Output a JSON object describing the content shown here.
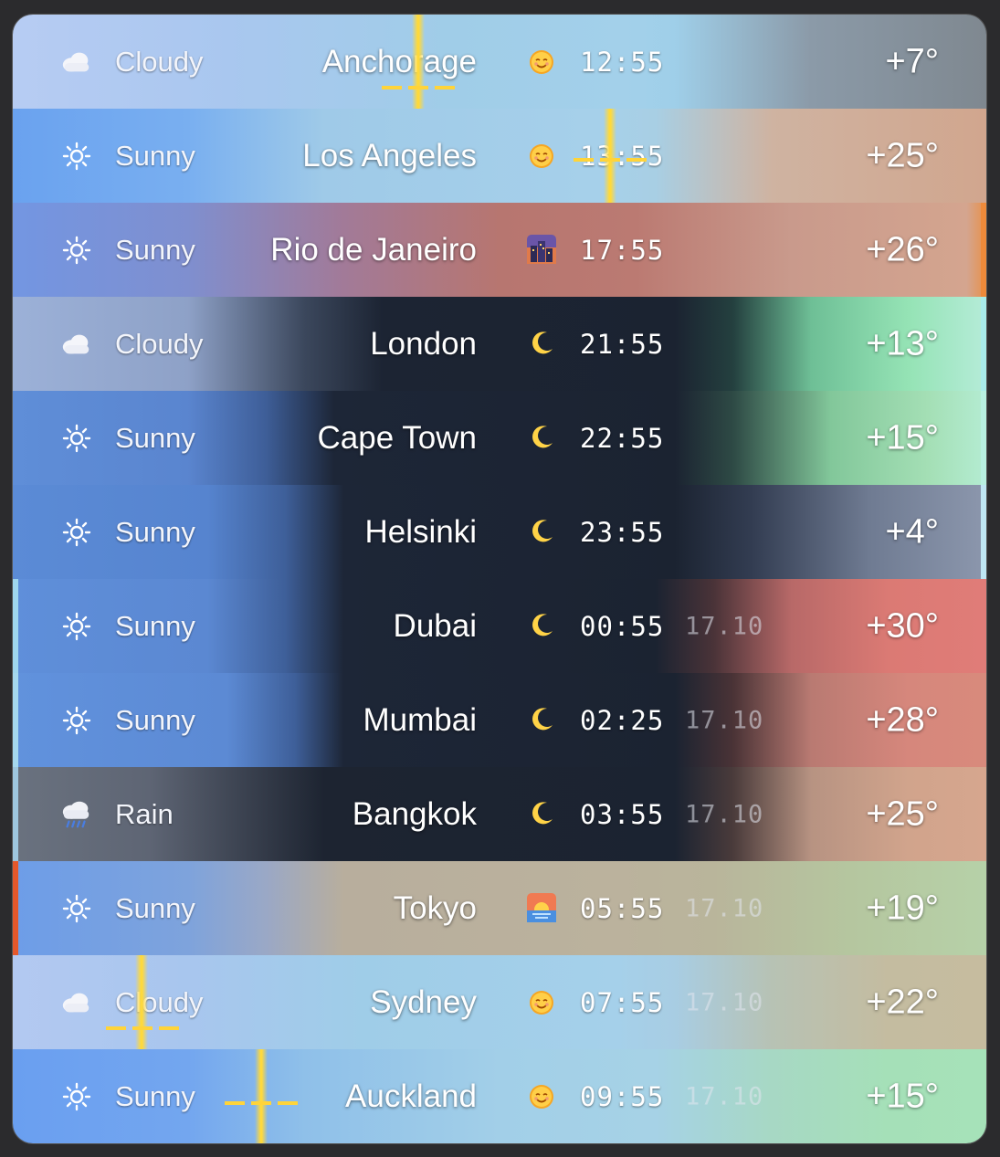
{
  "rows": [
    {
      "condition": "Cloudy",
      "cond_icon": "cloud-icon",
      "city": "Anchorage",
      "tod_icon": "sun-face-icon",
      "tod_glyph": "🌞",
      "time": "12:55",
      "date": "",
      "temp": "+7°",
      "bg": "linear-gradient(90deg,#b7ccf3 0%,#a9c7ef 22%,#a0cde8 45%,#a3d0ea 63%,#9fcfe9 68%,#8b9aa8 82%,#7f8890 100%)"
    },
    {
      "condition": "Sunny",
      "cond_icon": "sun-outline-icon",
      "city": "Los Angeles",
      "tod_icon": "sun-face-icon",
      "tod_glyph": "🌞",
      "time": "13:55",
      "date": "",
      "temp": "+25°",
      "bg": "linear-gradient(90deg,#6aa2ef 0%,#79aff0 18%,#9fcae8 32%,#a6d0ea 60%,#a8cfe4 66%,#cfb3a1 78%,#d1a68e 100%)"
    },
    {
      "condition": "Sunny",
      "cond_icon": "sun-outline-icon",
      "city": "Rio de Janeiro",
      "tod_icon": "dusk-city-icon",
      "tod_glyph": "🌆",
      "time": "17:55",
      "date": "",
      "temp": "+26°",
      "bg": "linear-gradient(90deg,#7396e2 0%,#7f8fcf 18%,#a27a98 34%,#b77670 50%,#bb7a72 64%,#c99a8c 80%,#d4a58f 98%,#e8914a 100%)"
    },
    {
      "condition": "Cloudy",
      "cond_icon": "cloud-icon",
      "city": "London",
      "tod_icon": "moon-icon",
      "tod_glyph": "🌙",
      "time": "21:55",
      "date": "",
      "temp": "+13°",
      "bg": "linear-gradient(90deg,#9cb1d8 0%,#8ea1c7 18%,#3b475c 30%,#1c2433 38%,#1b2331 68%,#24403f 74%,#6ebf96 82%,#95e3b5 92%,#b5ecd8 100%)"
    },
    {
      "condition": "Sunny",
      "cond_icon": "sun-outline-icon",
      "city": "Cape Town",
      "tod_icon": "moon-icon",
      "tod_glyph": "🌙",
      "time": "22:55",
      "date": "",
      "temp": "+15°",
      "bg": "linear-gradient(90deg,#5f8ed8 0%,#5a85cf 18%,#3e5e98 26%,#1d2637 33%,#1b2331 68%,#2e4a45 74%,#82c79a 84%,#a4dfb5 94%,#b4ecd2 100%)"
    },
    {
      "condition": "Sunny",
      "cond_icon": "sun-outline-icon",
      "city": "Helsinki",
      "tod_icon": "moon-icon",
      "tod_glyph": "🌙",
      "time": "23:55",
      "date": "",
      "temp": "+4°",
      "bg": "linear-gradient(90deg,#5b8bd6 0%,#5684cf 20%,#3e5f99 28%,#1d2637 34%,#1b2331 68%,#333d52 76%,#6f7b92 88%,#8c97ad 100%)"
    },
    {
      "condition": "Sunny",
      "cond_icon": "sun-outline-icon",
      "city": "Dubai",
      "tod_icon": "moon-icon",
      "tod_glyph": "🌙",
      "time": "00:55",
      "date": "17.10",
      "temp": "+30°",
      "bg": "linear-gradient(90deg,#5f8fda 0%,#5b88d2 20%,#3e5f99 28%,#1d2637 34%,#1b2331 66%,#4a3338 72%,#b86968 80%,#db7a74 90%,#e07c78 100%)"
    },
    {
      "condition": "Sunny",
      "cond_icon": "sun-outline-icon",
      "city": "Mumbai",
      "tod_icon": "moon-icon",
      "tod_glyph": "🌙",
      "time": "02:25",
      "date": "17.10",
      "temp": "+28°",
      "bg": "linear-gradient(90deg,#6192dd 0%,#5c8ad4 22%,#3e5f99 29%,#1d2637 34%,#1b2331 68%,#4a3336 74%,#b97a72 82%,#d6877c 92%,#d88a7c 100%)"
    },
    {
      "condition": "Rain",
      "cond_icon": "rain-cloud-icon",
      "city": "Bangkok",
      "tod_icon": "moon-icon",
      "tod_glyph": "🌙",
      "time": "03:55",
      "date": "17.10",
      "temp": "+25°",
      "bg": "linear-gradient(90deg,#6a727f 0%,#5e6574 14%,#3a414f 24%,#1d2431 32%,#1b2331 68%,#4a3b3b 74%,#b79382 82%,#d1a48c 92%,#d6a68e 100%)"
    },
    {
      "condition": "Sunny",
      "cond_icon": "sun-outline-icon",
      "city": "Tokyo",
      "tod_icon": "sunrise-icon",
      "tod_glyph": "🌅",
      "time": "05:55",
      "date": "17.10",
      "temp": "+19°",
      "bg": "linear-gradient(90deg,#6d9de8 0%,#7ea3dc 18%,#9aa8c6 26%,#b8ae9d 34%,#bbb29d 62%,#b9b59b 72%,#b5c69f 86%,#b6d1a8 100%)"
    },
    {
      "condition": "Cloudy",
      "cond_icon": "cloud-icon",
      "city": "Sydney",
      "tod_icon": "sun-face-icon",
      "tod_glyph": "🌞",
      "time": "07:55",
      "date": "17.10",
      "temp": "+22°",
      "bg": "linear-gradient(90deg,#b3c9f1 0%,#a8c6ee 18%,#9fcde8 36%,#a5d0ea 62%,#a8cde3 68%,#b7c2b4 78%,#c4bca0 90%,#c6bc9f 100%)"
    },
    {
      "condition": "Sunny",
      "cond_icon": "sun-outline-icon",
      "city": "Auckland",
      "tod_icon": "sun-face-icon",
      "tod_glyph": "🌞",
      "time": "09:55",
      "date": "17.10",
      "temp": "+15°",
      "bg": "linear-gradient(90deg,#6a9ff0 0%,#73a6ef 18%,#8fc0e9 30%,#a2cfe8 50%,#a6d2e6 66%,#a7d8c4 78%,#a5e0b8 90%,#a6e2b9 100%)"
    }
  ]
}
